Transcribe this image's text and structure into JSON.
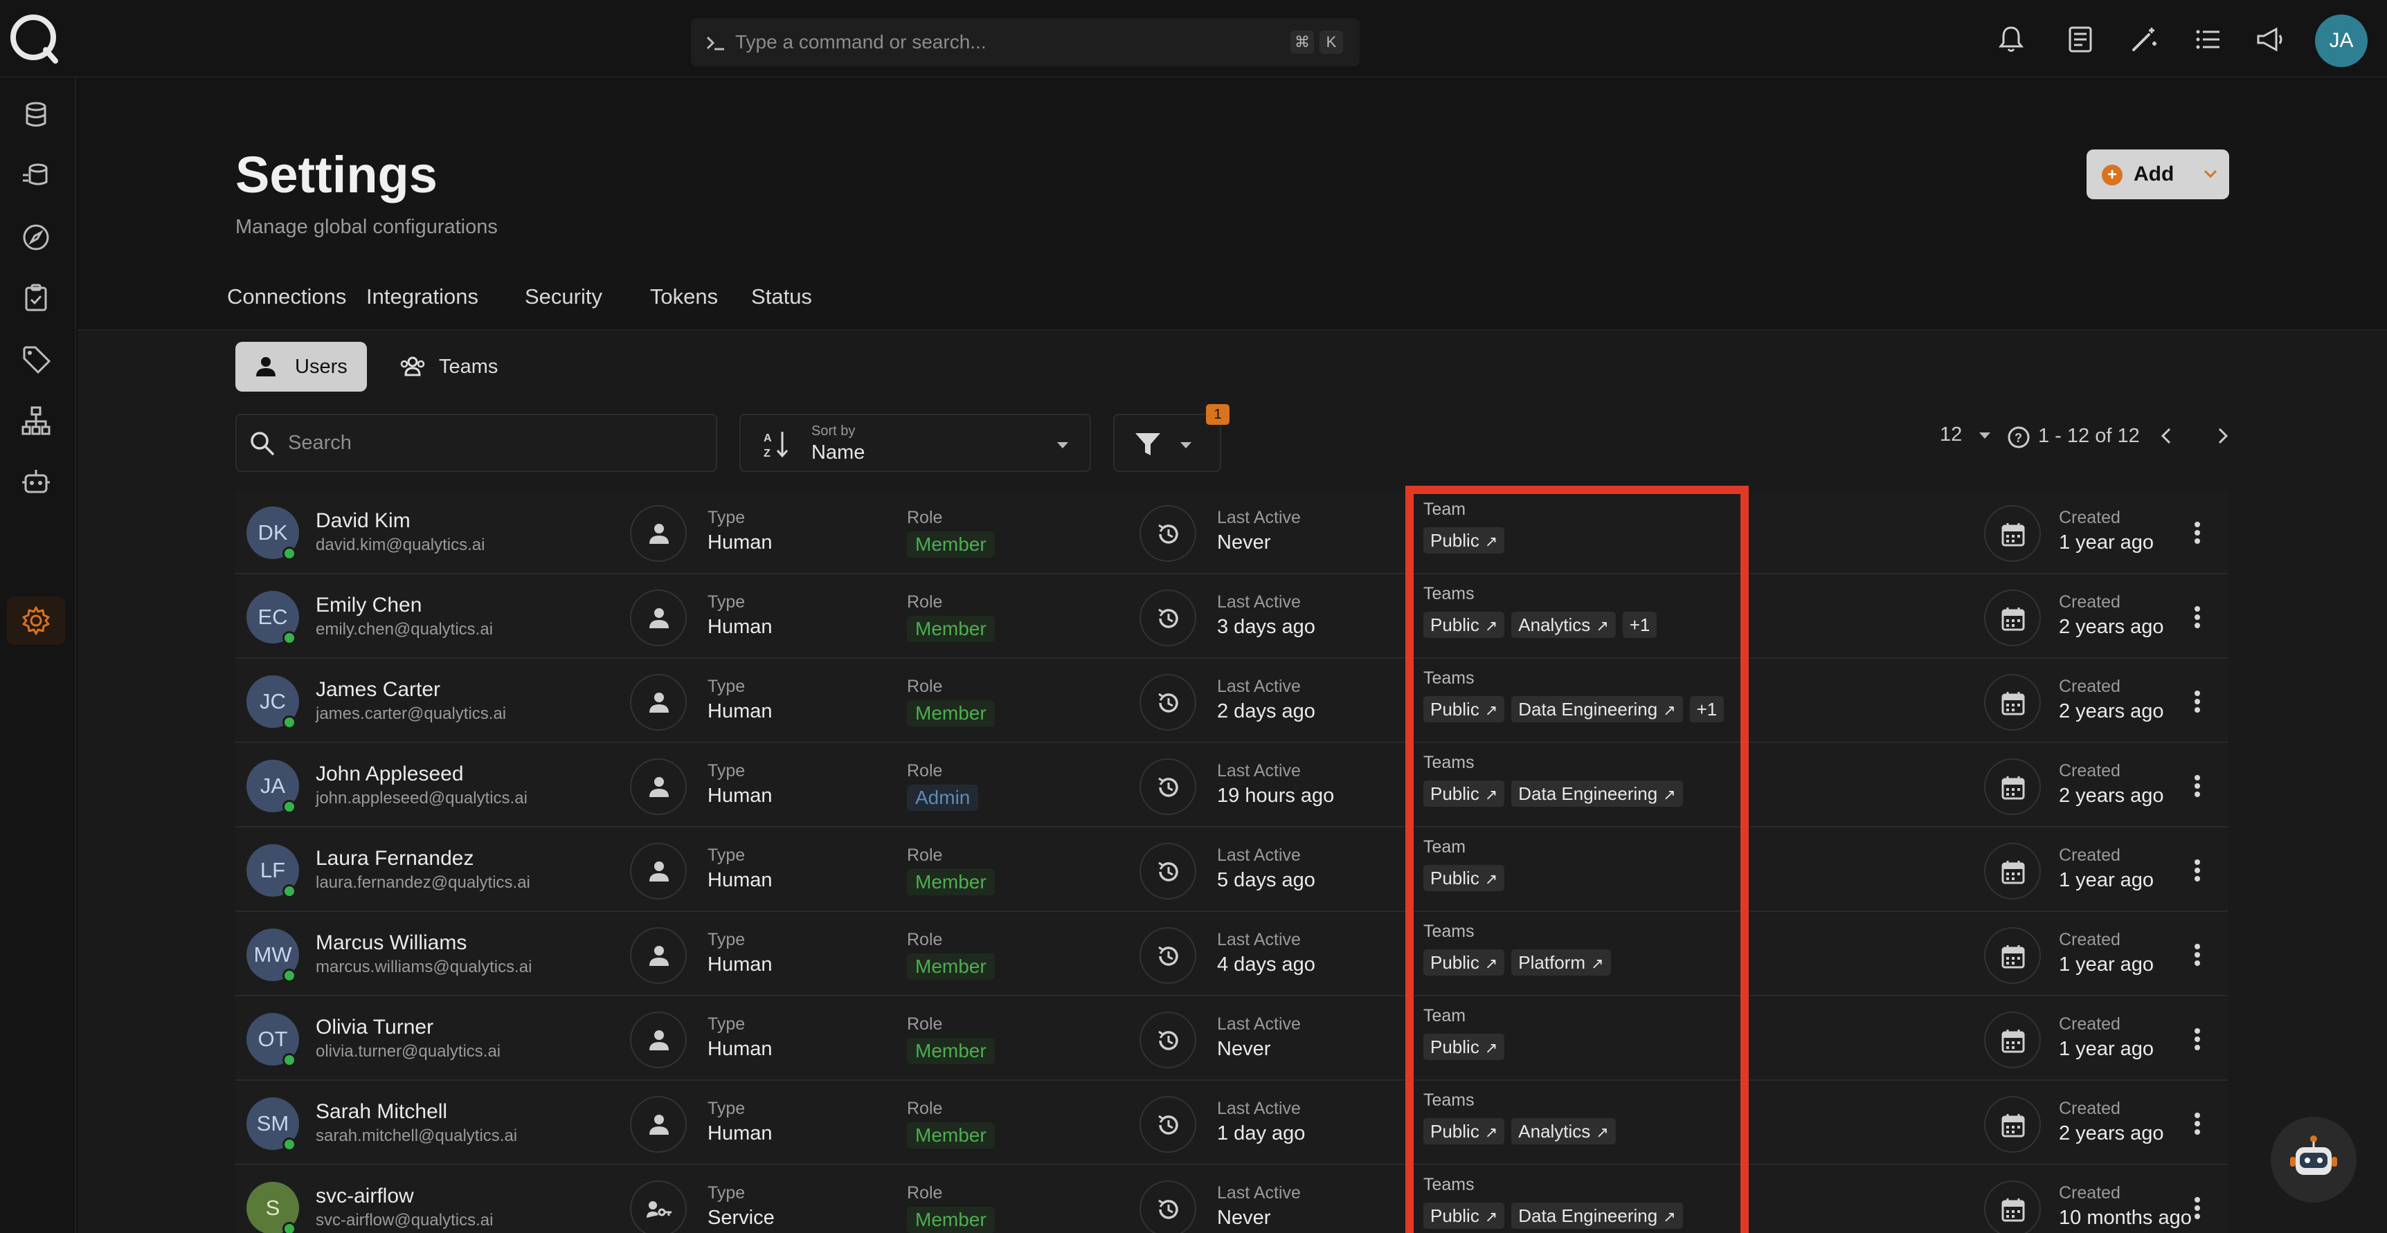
{
  "command_bar": {
    "placeholder": "Type a command or search...",
    "key1": "⌘",
    "key2": "K"
  },
  "user_initials": "JA",
  "page": {
    "title": "Settings",
    "subtitle": "Manage global configurations",
    "add_label": "Add"
  },
  "tabs": [
    {
      "label": "Connections"
    },
    {
      "label": "Integrations"
    },
    {
      "label": "Security",
      "active": true
    },
    {
      "label": "Tokens"
    },
    {
      "label": "Status"
    }
  ],
  "segments": {
    "users": "Users",
    "teams": "Teams"
  },
  "search": {
    "placeholder": "Search"
  },
  "sort": {
    "caption": "Sort by",
    "value": "Name"
  },
  "filter": {
    "count": "1"
  },
  "pagination": {
    "per_page": "12",
    "range": "1 - 12 of 12"
  },
  "columns": {
    "type": "Type",
    "role": "Role",
    "last_active": "Last Active",
    "created": "Created"
  },
  "users": [
    {
      "initials": "DK",
      "name": "David Kim",
      "email": "david.kim@qualytics.ai",
      "type": "Human",
      "role": "Member",
      "last_active": "Never",
      "team_caption": "Team",
      "teams": [
        "Public"
      ],
      "extra": "",
      "created": "1 year ago"
    },
    {
      "initials": "EC",
      "name": "Emily Chen",
      "email": "emily.chen@qualytics.ai",
      "type": "Human",
      "role": "Member",
      "last_active": "3 days ago",
      "team_caption": "Teams",
      "teams": [
        "Public",
        "Analytics"
      ],
      "extra": "+1",
      "created": "2 years ago"
    },
    {
      "initials": "JC",
      "name": "James Carter",
      "email": "james.carter@qualytics.ai",
      "type": "Human",
      "role": "Member",
      "last_active": "2 days ago",
      "team_caption": "Teams",
      "teams": [
        "Public",
        "Data Engineering"
      ],
      "extra": "+1",
      "created": "2 years ago"
    },
    {
      "initials": "JA",
      "name": "John Appleseed",
      "email": "john.appleseed@qualytics.ai",
      "type": "Human",
      "role": "Admin",
      "last_active": "19 hours ago",
      "team_caption": "Teams",
      "teams": [
        "Public",
        "Data Engineering"
      ],
      "extra": "",
      "created": "2 years ago"
    },
    {
      "initials": "LF",
      "name": "Laura Fernandez",
      "email": "laura.fernandez@qualytics.ai",
      "type": "Human",
      "role": "Member",
      "last_active": "5 days ago",
      "team_caption": "Team",
      "teams": [
        "Public"
      ],
      "extra": "",
      "created": "1 year ago"
    },
    {
      "initials": "MW",
      "name": "Marcus Williams",
      "email": "marcus.williams@qualytics.ai",
      "type": "Human",
      "role": "Member",
      "last_active": "4 days ago",
      "team_caption": "Teams",
      "teams": [
        "Public",
        "Platform"
      ],
      "extra": "",
      "created": "1 year ago"
    },
    {
      "initials": "OT",
      "name": "Olivia Turner",
      "email": "olivia.turner@qualytics.ai",
      "type": "Human",
      "role": "Member",
      "last_active": "Never",
      "team_caption": "Team",
      "teams": [
        "Public"
      ],
      "extra": "",
      "created": "1 year ago"
    },
    {
      "initials": "SM",
      "name": "Sarah Mitchell",
      "email": "sarah.mitchell@qualytics.ai",
      "type": "Human",
      "role": "Member",
      "last_active": "1 day ago",
      "team_caption": "Teams",
      "teams": [
        "Public",
        "Analytics"
      ],
      "extra": "",
      "created": "2 years ago"
    },
    {
      "initials": "S",
      "name": "svc-airflow",
      "email": "svc-airflow@qualytics.ai",
      "type": "Service",
      "role": "Member",
      "last_active": "Never",
      "team_caption": "Teams",
      "teams": [
        "Public",
        "Data Engineering"
      ],
      "extra": "",
      "created": "10 months ago"
    }
  ],
  "colors": {
    "accent": "#d9731e",
    "highlight": "#e03a26",
    "member": "#4caf50",
    "admin": "#5b8db8",
    "online": "#36b24a"
  }
}
